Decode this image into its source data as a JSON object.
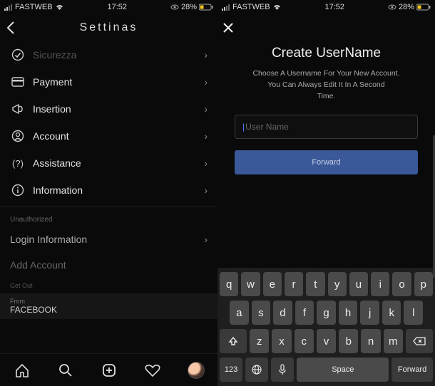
{
  "status": {
    "carrier": "FASTWEB",
    "time": "17:52",
    "battery_pct": "28%"
  },
  "left": {
    "title": "Settinas",
    "rows": [
      {
        "icon": "shield-icon",
        "label": "Sicurezza"
      },
      {
        "icon": "card-icon",
        "label": "Payment"
      },
      {
        "icon": "megaphone-icon",
        "label": "Insertion"
      },
      {
        "icon": "person-icon",
        "label": "Account"
      },
      {
        "icon": "help-icon",
        "label": "Assistance"
      },
      {
        "icon": "info-icon",
        "label": "Information"
      }
    ],
    "section_unauth": "Unauthorized",
    "login_info": "Login Information",
    "add_account": "Add Account",
    "get_out": "Get Out",
    "from_label": "From",
    "from_value": "FACEBOOK"
  },
  "right": {
    "title": "Create UserName",
    "sub1": "Choose A Username For Your New Account.",
    "sub2": "You Can Always Edit It In A Second",
    "sub3": "Time.",
    "placeholder": "User Name",
    "forward": "Forward"
  },
  "keyboard": {
    "r1": [
      "q",
      "w",
      "e",
      "r",
      "t",
      "y",
      "u",
      "i",
      "o",
      "p"
    ],
    "r2": [
      "a",
      "s",
      "d",
      "f",
      "g",
      "h",
      "j",
      "k",
      "l"
    ],
    "r3": [
      "z",
      "x",
      "c",
      "v",
      "b",
      "n",
      "m"
    ],
    "num": "123",
    "space": "Space",
    "enter": "Forward"
  }
}
